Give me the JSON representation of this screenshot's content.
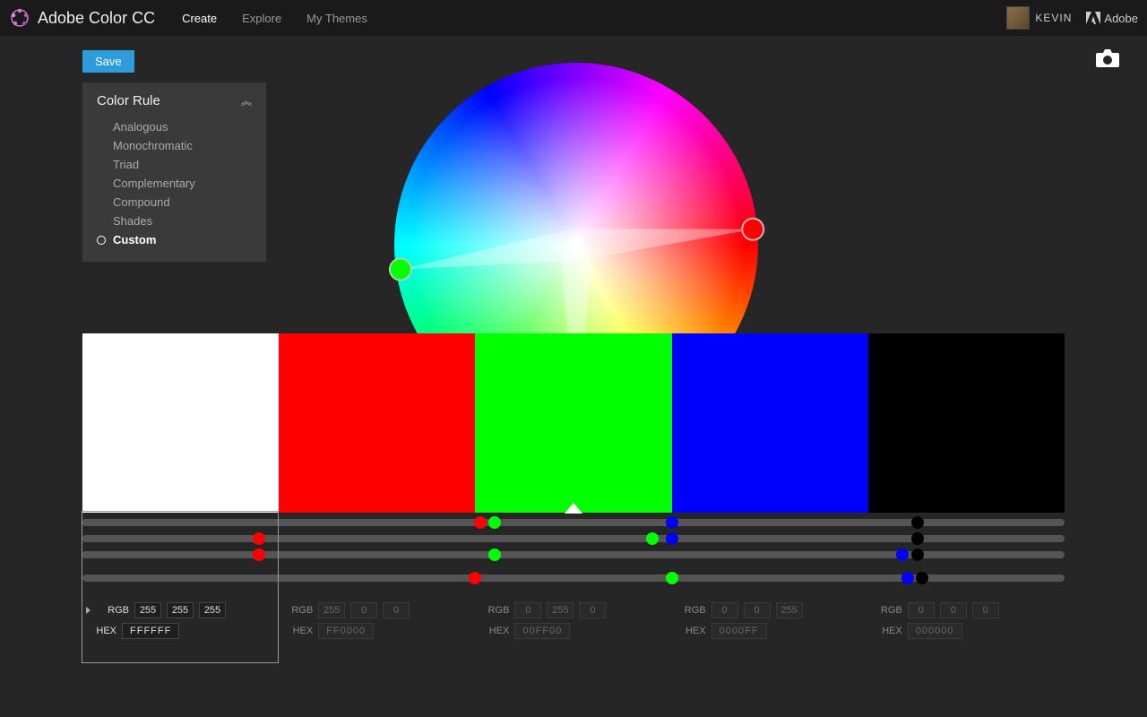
{
  "header": {
    "app_name": "Adobe Color CC",
    "nav": [
      "Create",
      "Explore",
      "My Themes"
    ],
    "nav_active": 0,
    "username": "KEVIN",
    "brand": "Adobe"
  },
  "toolbar": {
    "save_label": "Save"
  },
  "rule_panel": {
    "title": "Color Rule",
    "items": [
      "Analogous",
      "Monochromatic",
      "Triad",
      "Complementary",
      "Compound",
      "Shades",
      "Custom"
    ],
    "selected": 6
  },
  "wheel": {
    "arms": [
      {
        "angle": 172,
        "length": 198,
        "color": "#00ff00"
      },
      {
        "angle": 90,
        "length": 218,
        "color": "#0000ff"
      },
      {
        "angle": -5,
        "length": 198,
        "color": "#ff0000"
      }
    ]
  },
  "swatches": [
    {
      "hex": "FFFFFF",
      "rgb": [
        255,
        255,
        255
      ],
      "active": true
    },
    {
      "hex": "FF0000",
      "rgb": [
        255,
        0,
        0
      ]
    },
    {
      "hex": "00FF00",
      "rgb": [
        0,
        255,
        0
      ]
    },
    {
      "hex": "0000FF",
      "rgb": [
        0,
        0,
        255
      ]
    },
    {
      "hex": "000000",
      "rgb": [
        0,
        0,
        0
      ]
    }
  ],
  "labels": {
    "rgb": "RGB",
    "hex": "HEX"
  },
  "slider_tracks": [
    "white",
    "white2",
    "white3",
    "gap",
    "bright"
  ],
  "slider_dots_row1": [
    {
      "pct": 40.5,
      "color": "#ff0000"
    },
    {
      "pct": 42,
      "color": "#00ff00"
    },
    {
      "pct": 60,
      "color": "#0000ff"
    },
    {
      "pct": 85,
      "color": "#000000"
    }
  ],
  "slider_dots_row2": [
    {
      "pct": 18,
      "color": "#ff0000"
    },
    {
      "pct": 58,
      "color": "#00ff00"
    },
    {
      "pct": 60,
      "color": "#0000ff"
    },
    {
      "pct": 85,
      "color": "#000000"
    }
  ],
  "slider_dots_row3": [
    {
      "pct": 18,
      "color": "#ff0000"
    },
    {
      "pct": 42,
      "color": "#00ff00"
    },
    {
      "pct": 83.5,
      "color": "#0000ff"
    },
    {
      "pct": 85,
      "color": "#000000"
    }
  ],
  "slider_dots_bright": [
    {
      "pct": 40,
      "color": "#ff0000"
    },
    {
      "pct": 60,
      "color": "#00ff00"
    },
    {
      "pct": 84,
      "color": "#0000ff"
    },
    {
      "pct": 85.5,
      "color": "#000000"
    }
  ]
}
